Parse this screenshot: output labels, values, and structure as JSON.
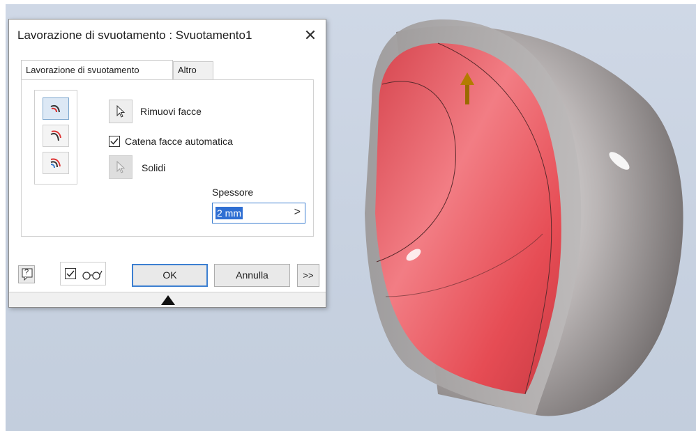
{
  "dialog": {
    "title": "Lavorazione di svuotamento : Svuotamento1",
    "tabs": [
      {
        "label": "Lavorazione di svuotamento",
        "active": true
      },
      {
        "label": "Altro",
        "active": false
      }
    ],
    "side_icons": [
      "shell-inside-icon",
      "shell-outside-icon",
      "shell-both-icon"
    ],
    "remove_faces_label": "Rimuovi facce",
    "auto_chain": {
      "label": "Catena facce automatica",
      "checked": true
    },
    "solids_label": "Solidi",
    "thickness": {
      "label": "Spessore",
      "value": "2 mm"
    },
    "preview_checked": true,
    "buttons": {
      "help": "?",
      "ok": "OK",
      "cancel": "Annulla",
      "more": ">>"
    }
  },
  "colors": {
    "accent": "#3c7fd1",
    "shell_face": "#e85f66",
    "viewport_bg": "#c9d3e2"
  }
}
